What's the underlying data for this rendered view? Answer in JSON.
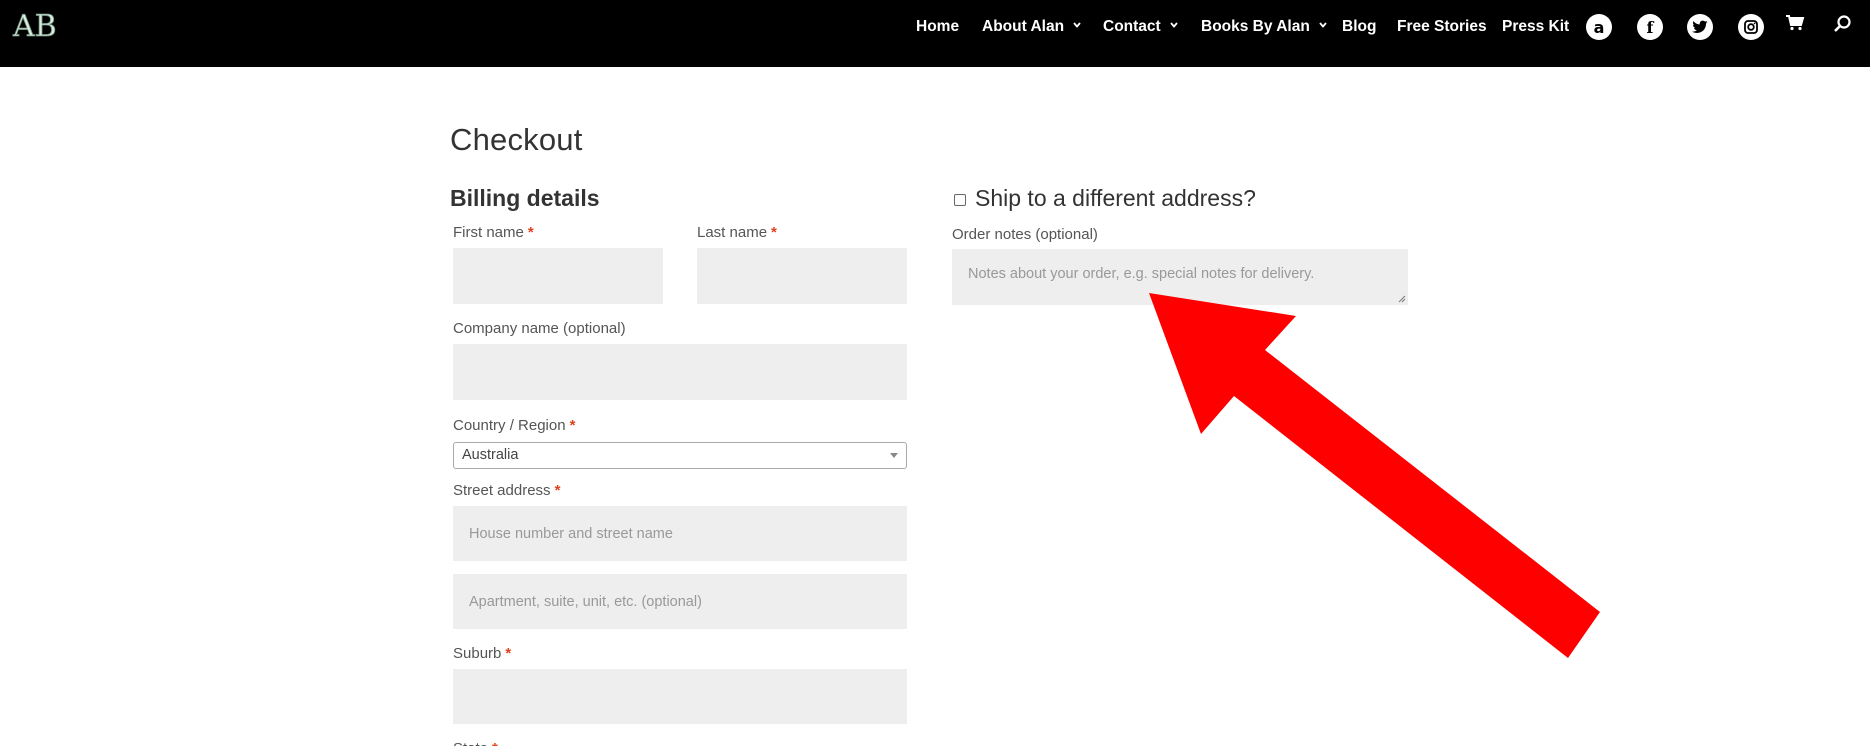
{
  "header": {
    "logo_text": "AB",
    "nav": [
      {
        "label": "Home",
        "dropdown": false
      },
      {
        "label": "About Alan",
        "dropdown": true
      },
      {
        "label": "Contact",
        "dropdown": true
      },
      {
        "label": "Books By Alan",
        "dropdown": true
      },
      {
        "label": "Blog",
        "dropdown": false
      },
      {
        "label": "Free Stories",
        "dropdown": false
      },
      {
        "label": "Press Kit",
        "dropdown": false
      }
    ],
    "social": [
      {
        "icon": "amazon-icon",
        "glyph": "a"
      },
      {
        "icon": "facebook-icon",
        "glyph": "f"
      },
      {
        "icon": "twitter-icon",
        "glyph": "🐦"
      },
      {
        "icon": "instagram-icon",
        "glyph": "◎"
      }
    ],
    "cart_icon": "cart-icon",
    "search_icon": "search-icon"
  },
  "checkout": {
    "title": "Checkout",
    "billing_title": "Billing details",
    "ship_different": "Ship to a different address?",
    "fields": {
      "first_name": "First name",
      "last_name": "Last name",
      "company": "Company name (optional)",
      "country": "Country / Region",
      "country_value": "Australia",
      "street": "Street address",
      "street_ph1": "House number and street name",
      "street_ph2": "Apartment, suite, unit, etc. (optional)",
      "suburb": "Suburb",
      "state": "State"
    },
    "required_mark": "*",
    "order_notes_label": "Order notes (optional)",
    "order_notes_ph": "Notes about your order, e.g. special notes for delivery."
  },
  "annotation": {
    "color": "#ff0000"
  }
}
